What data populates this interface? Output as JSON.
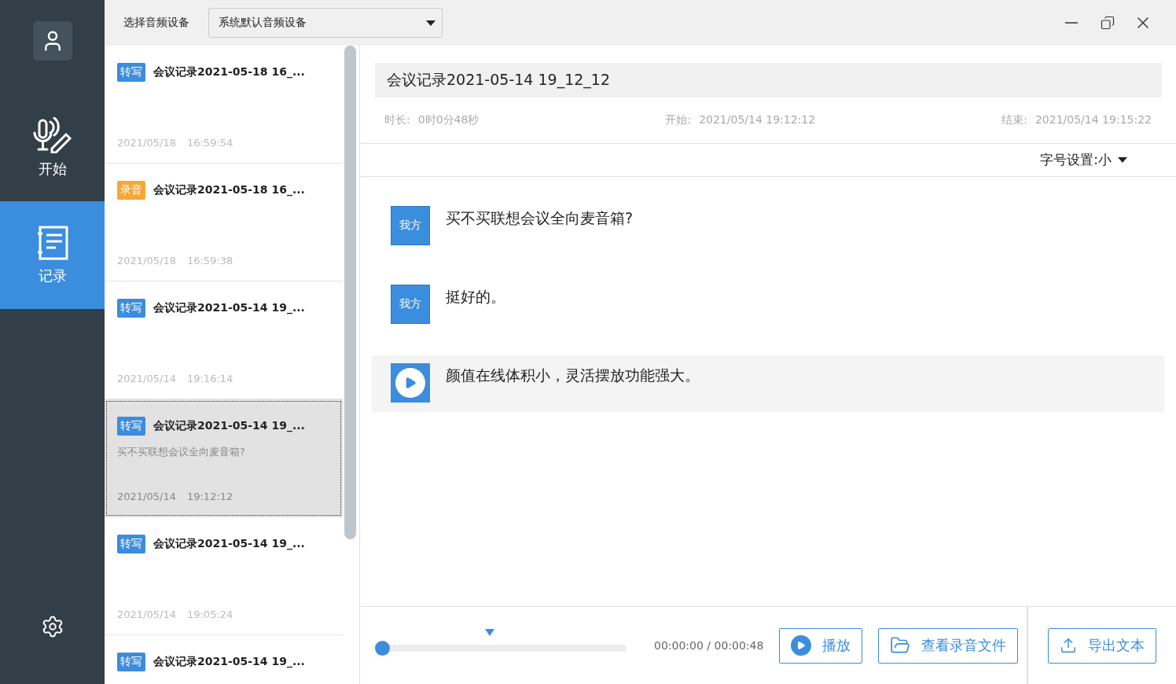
{
  "sidebar": {
    "items": [
      {
        "kind": "start",
        "label": "开始",
        "selected": false
      },
      {
        "kind": "records",
        "label": "记录",
        "selected": true
      }
    ]
  },
  "device": {
    "label": "选择音频设备",
    "value": "系统默认音频设备"
  },
  "records": [
    {
      "tag": "转写",
      "color": "#3b8ddd",
      "title": "会议记录2021-05-18 16_...",
      "date": "2021/05/18",
      "time": "16:59:54",
      "selected": false
    },
    {
      "tag": "录音",
      "color": "#f8a832",
      "title": "会议记录2021-05-18 16_...",
      "date": "2021/05/18",
      "time": "16:59:38",
      "selected": false
    },
    {
      "tag": "转写",
      "color": "#3b8ddd",
      "title": "会议记录2021-05-14 19_...",
      "date": "2021/05/14",
      "time": "19:16:14",
      "selected": false
    },
    {
      "tag": "转写",
      "color": "#3b8ddd",
      "title": "会议记录2021-05-14 19_...",
      "preview": "买不买联想会议全向麦音箱?",
      "date": "2021/05/14",
      "time": "19:12:12",
      "selected": true
    },
    {
      "tag": "转写",
      "color": "#3b8ddd",
      "title": "会议记录2021-05-14 19_...",
      "date": "2021/05/14",
      "time": "19:05:24",
      "selected": false
    },
    {
      "tag": "转写",
      "color": "#3b8ddd",
      "title": "会议记录2021-05-14 19_...",
      "selected": false
    }
  ],
  "detail": {
    "title": "会议记录2021-05-14 19_12_12",
    "meta": [
      {
        "label": "时长:",
        "value": "0时0分48秒"
      },
      {
        "label": "开始:",
        "value": "2021/05/14 19:12:12"
      },
      {
        "label": "结束:",
        "value": "2021/05/14 19:15:22"
      }
    ],
    "font_setting": "字号设置:小",
    "lines": [
      {
        "speaker": "我方",
        "text": "买不买联想会议全向麦音箱?",
        "selected": false
      },
      {
        "speaker": "我方",
        "text": "挺好的。",
        "selected": false
      },
      {
        "text": "颜值在线体积小，灵活摆放功能强大。",
        "selected": true
      }
    ]
  },
  "player": {
    "level": 0,
    "time": "00:00:00 / 00:00:48",
    "buttons": [
      {
        "kind": "play",
        "label": "播放"
      },
      {
        "kind": "folder",
        "label": "查看录音文件"
      }
    ],
    "export": "导出文本"
  }
}
